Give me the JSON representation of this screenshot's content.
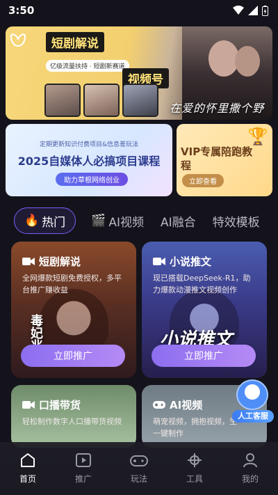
{
  "status": {
    "time": "3:50"
  },
  "hero": {
    "title_a": "短剧解说",
    "title_b": "视频号",
    "subtitle": "亿级流量扶持 · 短剧新赛道",
    "poster_text": "在爱的怀里撒个野"
  },
  "course": {
    "small": "定期更新知识付费项目&信息差玩法",
    "big": "2025自媒体人必搞项目课程",
    "button": "助力草根网络创业"
  },
  "vip": {
    "title": "VIP专属陪跑教程",
    "button": "立即查看"
  },
  "tabs": [
    {
      "label": "热门",
      "icon": "fire-icon"
    },
    {
      "label": "AI视频",
      "icon": "clapper-icon"
    },
    {
      "label": "AI融合"
    },
    {
      "label": "特效模板"
    }
  ],
  "cards": [
    {
      "title": "短剧解说",
      "desc": "全网爆款短剧免费授权，多平台推广赚收益",
      "button": "立即推广",
      "overlay": "毒妃兆"
    },
    {
      "title": "小说推文",
      "desc": "现已搭载DeepSeek-R1，助力爆款动漫推文视频创作",
      "button": "立即推广",
      "overlay": "小说推文"
    },
    {
      "title": "口播带货",
      "desc": "轻松制作数字人口播带货视频"
    },
    {
      "title": "AI视频",
      "desc": "萌宠视频，拥抱视频，生一键制作"
    }
  ],
  "support": {
    "label": "人工客服"
  },
  "nav": [
    {
      "label": "首页",
      "icon": "home-icon"
    },
    {
      "label": "推广",
      "icon": "play-icon"
    },
    {
      "label": "玩法",
      "icon": "gamepad-icon"
    },
    {
      "label": "工具",
      "icon": "tools-icon"
    },
    {
      "label": "我的",
      "icon": "profile-icon"
    }
  ]
}
